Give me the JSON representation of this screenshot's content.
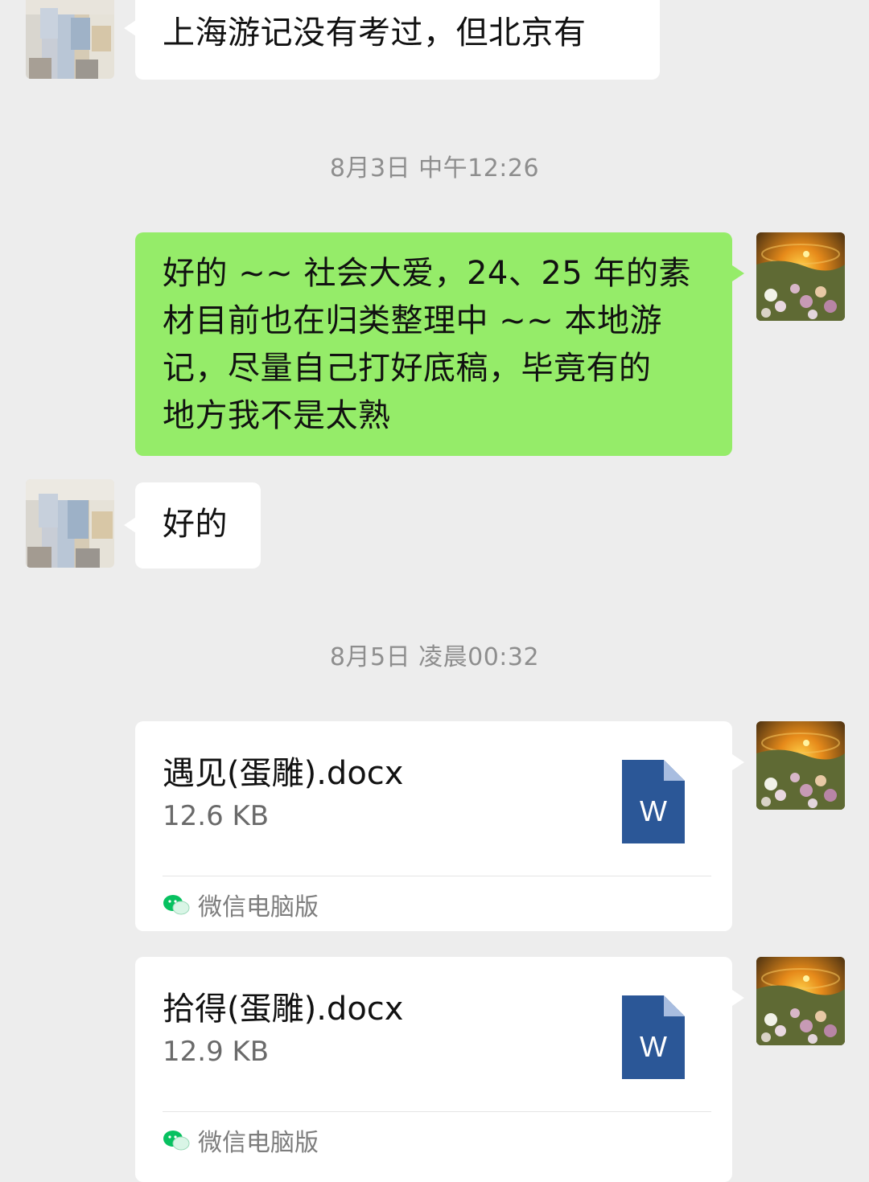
{
  "messages": [
    {
      "id": "m1",
      "side": "left",
      "text": "上海游记没有考过，但北京有"
    },
    {
      "id": "m2",
      "side": "right",
      "lines": [
        "好的 ~~ 社会大爱，24、25 年的素",
        "材目前也在归类整理中 ~~ 本地游",
        "记，尽量自己打好底稿，毕竟有的",
        "地方我不是太熟"
      ]
    },
    {
      "id": "m3",
      "side": "left",
      "text": "好的"
    },
    {
      "id": "f1",
      "side": "right",
      "file_name": "遇见(蛋雕).docx",
      "file_size": "12.6 KB",
      "source": "微信电脑版",
      "file_icon_letter": "W"
    },
    {
      "id": "f2",
      "side": "right",
      "file_name": "拾得(蛋雕).docx",
      "file_size": "12.9 KB",
      "source": "微信电脑版",
      "file_icon_letter": "W"
    }
  ],
  "timestamps": {
    "t1": "8月3日 中午12:26",
    "t2": "8月5日 凌晨00:32"
  },
  "colors": {
    "background": "#ededed",
    "bubble_left": "#ffffff",
    "bubble_right": "#95ec69",
    "timestamp_text": "#8e8e8e",
    "word_icon": "#2b5797",
    "wechat_green": "#07c160"
  },
  "icons": {
    "file_icon": "word-document-icon",
    "source_icon": "wechat-icon"
  }
}
